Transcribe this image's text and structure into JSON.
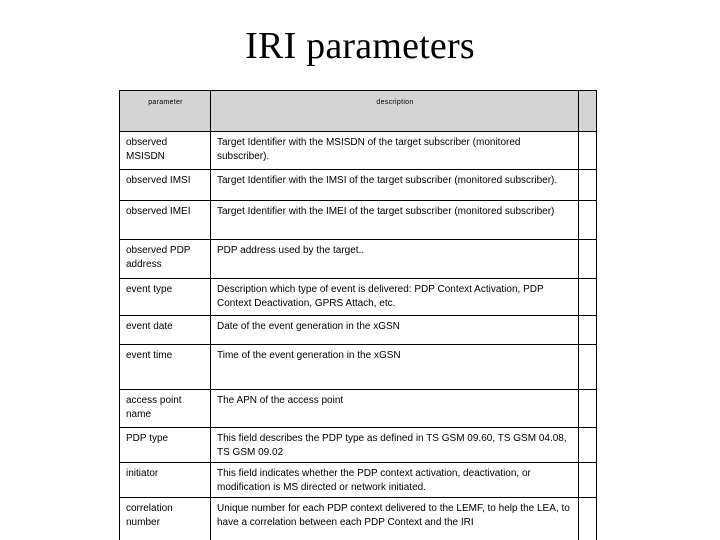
{
  "slide": {
    "title": "IRI parameters"
  },
  "table": {
    "headers": {
      "parameter": "parameter",
      "description": "description",
      "extra": ""
    },
    "colors": {
      "header_background": "#d4d4d4",
      "cell_background": "#ffffff",
      "border": "#000000",
      "text": "#000000",
      "slide_background": "#ffffff"
    },
    "rows": [
      {
        "parameter": "observed MSISDN",
        "description": "Target Identifier with the MSISDN of the target subscriber (monitored subscriber).",
        "extra": ""
      },
      {
        "parameter": "observed IMSI",
        "description": "Target Identifier with the IMSI of the target subscriber (monitored subscriber).",
        "extra": ""
      },
      {
        "parameter": "observed IMEI",
        "description": "Target Identifier with the IMEI of the target subscriber (monitored subscriber)",
        "extra": ""
      },
      {
        "parameter": "observed PDP address",
        "description": "PDP address used by the  target..",
        "extra": ""
      },
      {
        "parameter": "event type",
        "description": "Description which type of event is delivered: PDP Context Activation, PDP Context Deactivation, GPRS Attach, etc.",
        "extra": ""
      },
      {
        "parameter": "event date",
        "description": "Date of the event generation in the xGSN",
        "extra": ""
      },
      {
        "parameter": "event time",
        "description": "Time of the event generation in the xGSN",
        "extra": ""
      },
      {
        "parameter": "access point name",
        "description": "The APN of the access point",
        "extra": ""
      },
      {
        "parameter": "PDP type",
        "description": "This field describes the PDP type as defined in TS GSM 09.60, TS GSM 04.08, TS GSM 09.02",
        "extra": ""
      },
      {
        "parameter": "initiator",
        "description": "This field indicates whether the PDP context activation, deactivation, or modification is MS directed or network initiated.",
        "extra": ""
      },
      {
        "parameter": "correlation number",
        "description": "Unique number for each PDP context delivered to the LEMF, to help the LEA, to have a correlation between each  PDP Context and the IRI",
        "extra": ""
      }
    ]
  }
}
